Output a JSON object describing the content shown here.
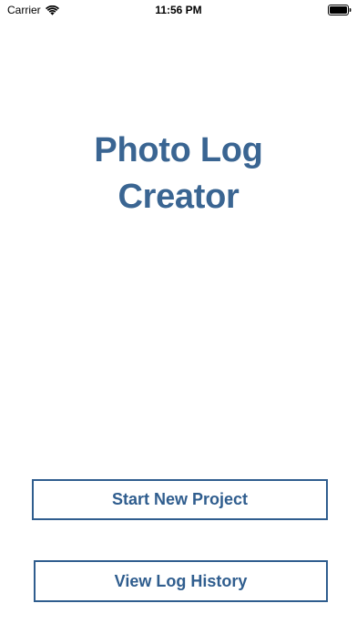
{
  "status_bar": {
    "carrier": "Carrier",
    "time": "11:56 PM",
    "icons": [
      "wifi-icon",
      "battery-icon"
    ]
  },
  "title": {
    "line1": "Photo Log",
    "line2": "Creator"
  },
  "buttons": {
    "start_new_project": "Start New Project",
    "view_log_history": "View Log History"
  },
  "colors": {
    "title": "#3a6592",
    "button_border": "#2f5d8e",
    "button_text": "#2f5d8e",
    "background": "#ffffff"
  }
}
